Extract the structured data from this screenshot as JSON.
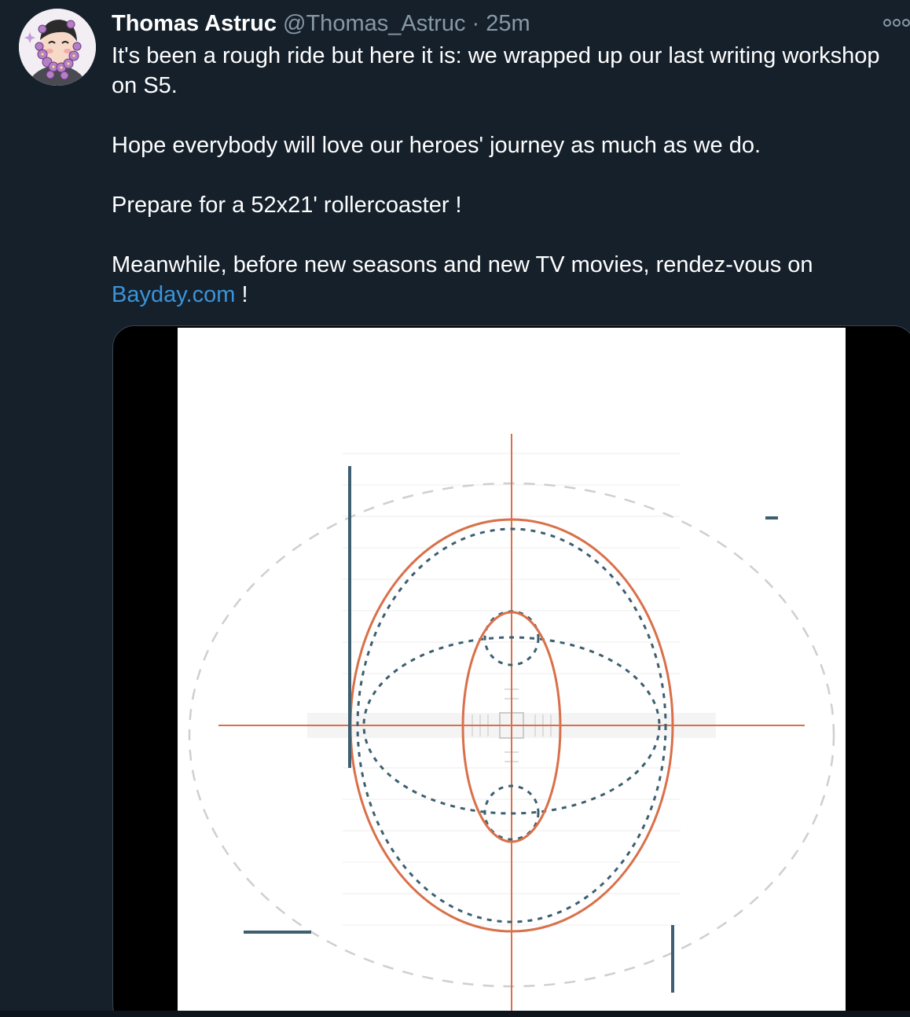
{
  "tweet": {
    "author_name": "Thomas Astruc",
    "handle": "@Thomas_Astruc",
    "separator": "·",
    "time": "25m",
    "paragraphs": [
      "It's been a rough ride but here it is: we wrapped up our last writing workshop on S5.",
      "Hope everybody will love our heroes' journey as much as we do.",
      "Prepare for a 52x21' rollercoaster !"
    ],
    "last_paragraph_prefix": "Meanwhile, before new seasons and new TV movies, rendez-vous on",
    "link_text": "Bayday.com",
    "last_paragraph_suffix": " !"
  },
  "icons": {
    "more": "more-options-icon",
    "avatar": "avatar-illustration"
  },
  "colors": {
    "background": "#15202b",
    "link": "#3b94d9",
    "muted": "#8899a6",
    "media_orange": "#d9704a",
    "media_teal": "#3d5f70"
  }
}
